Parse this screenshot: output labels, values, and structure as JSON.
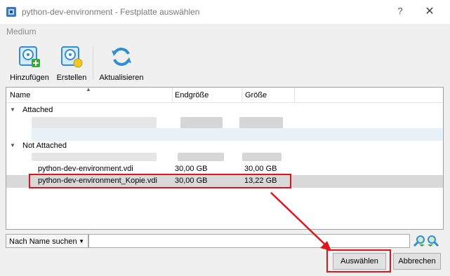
{
  "window": {
    "title": "python-dev-environment - Festplatte auswählen",
    "help_glyph": "?",
    "close_glyph": "✕"
  },
  "menubar": {
    "medium": "Medium"
  },
  "toolbar": {
    "add_label": "Hinzufügen",
    "create_label": "Erstellen",
    "refresh_label": "Aktualisieren"
  },
  "table": {
    "columns": [
      "Name",
      "Endgröße",
      "Größe"
    ],
    "groups": [
      {
        "label": "Attached"
      },
      {
        "label": "Not Attached"
      }
    ],
    "rows": [
      {
        "name": "python-dev-environment.vdi",
        "endsize": "30,00 GB",
        "size": "30,00 GB"
      },
      {
        "name": "python-dev-environment_Kopie.vdi",
        "endsize": "30,00 GB",
        "size": "13,22 GB"
      }
    ]
  },
  "search": {
    "mode": "Nach Name suchen",
    "value": ""
  },
  "buttons": {
    "choose": "Auswählen",
    "cancel": "Abbrechen"
  },
  "colors": {
    "annotation": "#e0141b",
    "selection": "#d9d9d9",
    "icon_blue": "#2f8fd6"
  }
}
